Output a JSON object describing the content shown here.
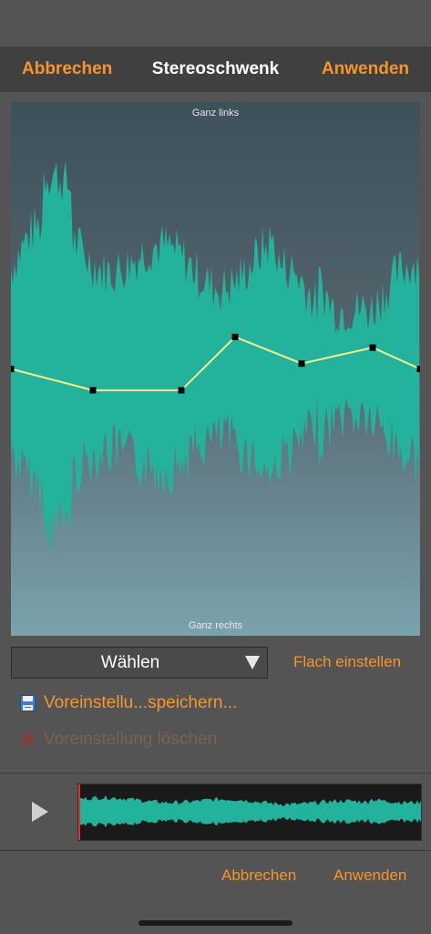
{
  "nav": {
    "cancel": "Abbrechen",
    "title": "Stereoschwenk",
    "apply": "Anwenden"
  },
  "editor": {
    "top_label": "Ganz links",
    "bottom_label": "Ganz rechts",
    "pan_points": [
      0.5,
      0.54,
      0.54,
      0.44,
      0.49,
      0.46,
      0.5
    ]
  },
  "select": {
    "label": "Wählen"
  },
  "flat_button": "Flach einstellen",
  "presets": {
    "save": {
      "label": "Voreinstellu...speichern...",
      "icon": "floppy-disk-icon"
    },
    "delete": {
      "label": "Voreinstellung löschen",
      "icon": "red-x-icon"
    }
  },
  "footer": {
    "cancel": "Abbrechen",
    "apply": "Anwenden"
  },
  "colors": {
    "accent": "#f5952c",
    "waveform": "#23b39c",
    "pan_line": "#f2f08a"
  }
}
